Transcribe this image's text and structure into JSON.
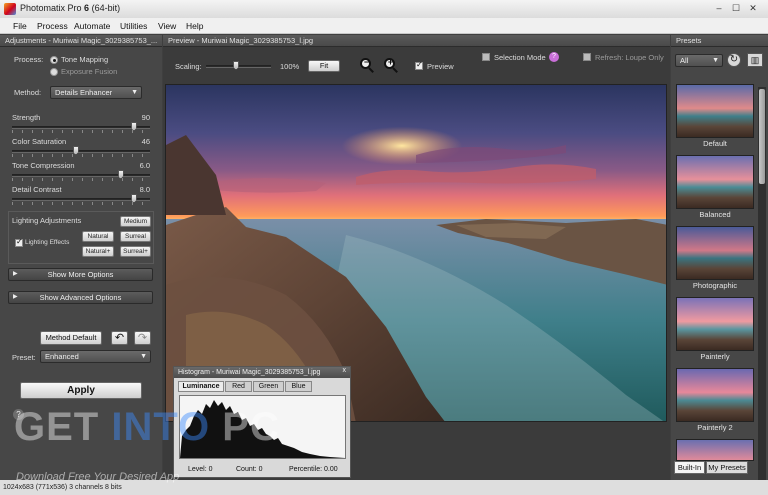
{
  "window": {
    "app_name": "Photomatix Pro",
    "version": "6",
    "arch": "(64-bit)",
    "controls": {
      "minimize": "–",
      "maximize": "☐",
      "close": "✕"
    }
  },
  "menu": [
    "File",
    "Process",
    "Automate",
    "Utilities",
    "View",
    "Help"
  ],
  "adjustments": {
    "header": "Adjustments - Muriwai Magic_3029385753_...",
    "process_label": "Process:",
    "process_options": [
      "Tone Mapping",
      "Exposure Fusion"
    ],
    "process_selected": "Tone Mapping",
    "method_label": "Method:",
    "method_value": "Details Enhancer",
    "sliders": [
      {
        "label": "Strength",
        "value": "90",
        "position": 0.9
      },
      {
        "label": "Color Saturation",
        "value": "46",
        "position": 0.46
      },
      {
        "label": "Tone Compression",
        "value": "6.0",
        "position": 0.8
      },
      {
        "label": "Detail Contrast",
        "value": "8.0",
        "position": 0.9
      }
    ],
    "lighting": {
      "title": "Lighting Adjustments",
      "effects_label": "Lighting Effects",
      "effects_checked": true,
      "buttons": [
        "Medium",
        "Natural",
        "Surreal",
        "Natural+",
        "Surreal+"
      ]
    },
    "show_more": "Show More Options",
    "show_advanced": "Show Advanced Options",
    "method_default": "Method Default",
    "undo_icon": "↶",
    "redo_icon": "↷",
    "preset_label": "Preset:",
    "preset_value": "Enhanced",
    "apply": "Apply",
    "help": "?"
  },
  "preview": {
    "header": "Preview - Muriwai Magic_3029385753_l.jpg",
    "scaling_label": "Scaling:",
    "scaling_value": "100%",
    "scaling_position": 0.45,
    "fit_button": "Fit",
    "preview_label": "Preview",
    "preview_checked": true,
    "selection_mode": "Selection Mode",
    "refresh_label": "Refresh: Loupe Only"
  },
  "histogram": {
    "title": "Histogram - Muriwai Magic_3029385753_l.jpg",
    "close": "x",
    "tabs": [
      "Luminance",
      "Red",
      "Green",
      "Blue"
    ],
    "active_tab": "Luminance",
    "level": "Level: 0",
    "count": "Count: 0",
    "percentile": "Percentile: 0.00"
  },
  "presets": {
    "header": "Presets",
    "filter": "All",
    "items": [
      "Default",
      "Balanced",
      "Photographic",
      "Painterly",
      "Painterly 2"
    ],
    "tabs": [
      "Built-In",
      "My Presets"
    ],
    "active_tab": "Built-In"
  },
  "status": "1024x683 (771x536) 3 channels 8 bits",
  "watermark": {
    "part1": "GET ",
    "part2": "INTO",
    "part3": " PC",
    "subtitle": "Download Free Your Desired App"
  }
}
